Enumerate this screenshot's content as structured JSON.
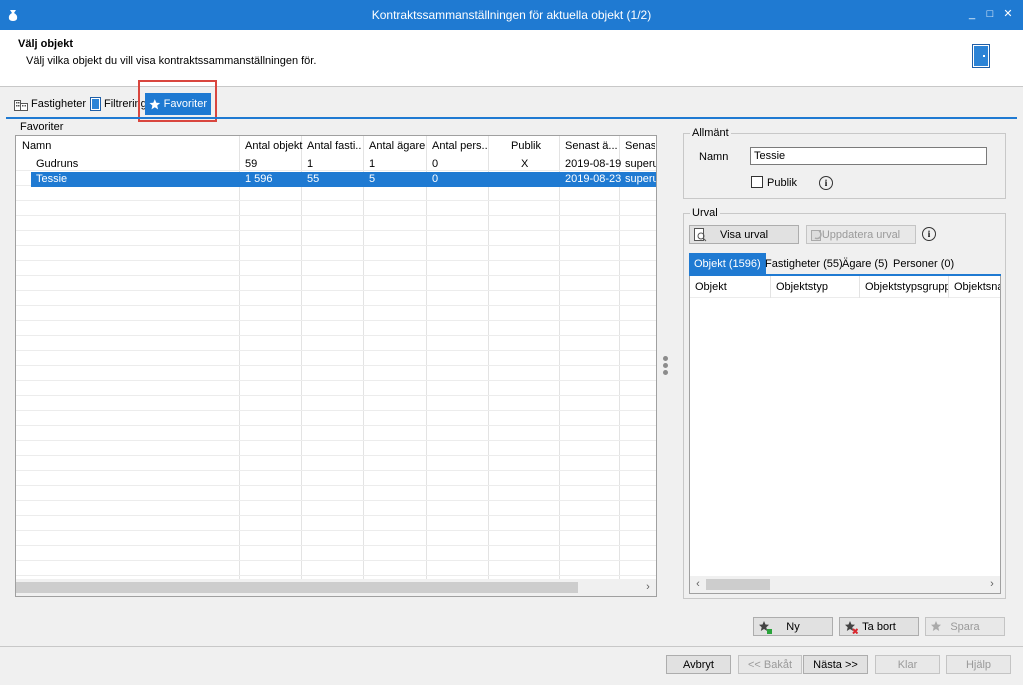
{
  "window": {
    "title": "Kontraktssammanställningen för aktuella objekt (1/2)",
    "minimize": "_",
    "maximize": "□",
    "close": "✕"
  },
  "header": {
    "title": "Välj objekt",
    "subtitle": "Välj vilka objekt du vill visa kontraktssammanställningen för."
  },
  "tabs": [
    {
      "label": "Fastigheter",
      "icon": "building-icon"
    },
    {
      "label": "Filtrering",
      "icon": "filter-icon"
    },
    {
      "label": "Favoriter",
      "icon": "star-icon",
      "active": true
    }
  ],
  "favorites": {
    "group_label": "Favoriter",
    "columns": [
      "Namn",
      "Antal objekt",
      "Antal fasti...",
      "Antal ägare",
      "Antal pers...",
      "Publik",
      "Senast ä...",
      "Senast"
    ],
    "rows": [
      {
        "namn": "Gudruns",
        "antal_objekt": "59",
        "antal_fastigheter": "1",
        "antal_agare": "1",
        "antal_personer": "0",
        "publik": "X",
        "senast_andrad": "2019-08-19",
        "senast_av": "superus"
      },
      {
        "namn": "Tessie",
        "antal_objekt": "1 596",
        "antal_fastigheter": "55",
        "antal_agare": "5",
        "antal_personer": "0",
        "publik": "",
        "senast_andrad": "2019-08-23",
        "senast_av": "superus",
        "selected": true
      }
    ],
    "scroll_left": "‹",
    "scroll_right": "›"
  },
  "general": {
    "group_label": "Allmänt",
    "name_label": "Namn",
    "name_value": "Tessie",
    "public_label": "Publik",
    "public_checked": false,
    "info": "i"
  },
  "selection": {
    "group_label": "Urval",
    "show_button": "Visa urval",
    "update_button": "Uppdatera urval",
    "info": "i",
    "tabs": [
      "Objekt (1596)",
      "Fastigheter (55)",
      "Ägare (5)",
      "Personer (0)"
    ],
    "columns": [
      "Objekt",
      "Objektstyp",
      "Objektstypsgrupp",
      "Objektsnam"
    ],
    "scroll_left": "‹",
    "scroll_right": "›"
  },
  "actions": {
    "new": "Ny",
    "delete": "Ta bort",
    "save": "Spara"
  },
  "wizard": {
    "cancel": "Avbryt",
    "back": "<< Bakåt",
    "next": "Nästa >>",
    "finish": "Klar",
    "help": "Hjälp"
  },
  "colors": {
    "accent": "#1f7ad2",
    "highlight": "#d9463e"
  }
}
